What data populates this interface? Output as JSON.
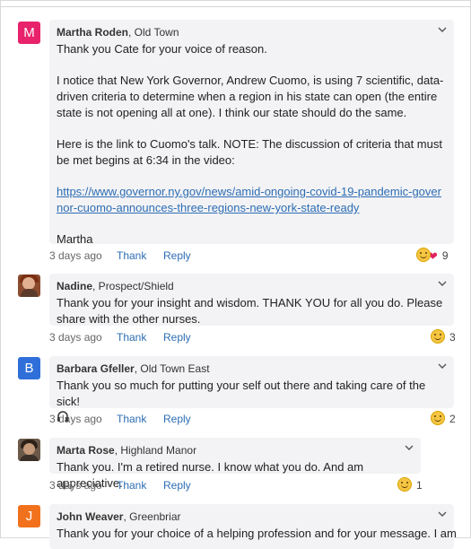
{
  "comments": [
    {
      "avatar_letter": "M",
      "avatar_color": "#e8236b",
      "author": "Martha Roden",
      "location": ", Old Town",
      "paragraphs": [
        "Thank you Cate for your voice of reason.",
        "I notice that New York Governor, Andrew Cuomo, is using 7 scientific, data-driven criteria to determine when a region in his state can open (the entire state is not opening all at one). I think our state should do the same.",
        "Here is the link to Cuomo's talk. NOTE: The discussion of criteria that must be met begins at 6:34 in the video:"
      ],
      "link": "https://www.governor.ny.gov/news/amid-ongoing-covid-19-pandemic-governor-cuomo-announces-three-regions-new-york-state-ready",
      "signoff": "Martha",
      "time": "3 days ago",
      "thank": "Thank",
      "reply": "Reply",
      "reaction_count": "9"
    },
    {
      "author": "Nadine",
      "location": ", Prospect/Shield",
      "text": "Thank you for your insight and wisdom.  THANK YOU for all you do.  Please share with the other nurses.",
      "time": "3 days ago",
      "thank": "Thank",
      "reply": "Reply",
      "reaction_count": "3"
    },
    {
      "avatar_letter": "B",
      "avatar_color": "#2f6fd9",
      "author": "Barbara Gfeller",
      "location": ", Old Town East",
      "text": "Thank you so much for putting your self out there and taking care of the sick!",
      "time": "3 days ago",
      "thank": "Thank",
      "reply": "Reply",
      "reaction_count": "2"
    },
    {
      "author": "Marta Rose",
      "location": ", Highland Manor",
      "text": "Thank you. I'm a retired nurse. I know what you do. And am appreciative.",
      "time": "3 days ago",
      "thank": "Thank",
      "reply": "Reply",
      "reaction_count": "1"
    },
    {
      "avatar_letter": "J",
      "avatar_color": "#f2711c",
      "author": "John Weaver",
      "location": ", Greenbriar",
      "text": "Thank you for your choice of a helping profession and for your message. I am"
    }
  ]
}
